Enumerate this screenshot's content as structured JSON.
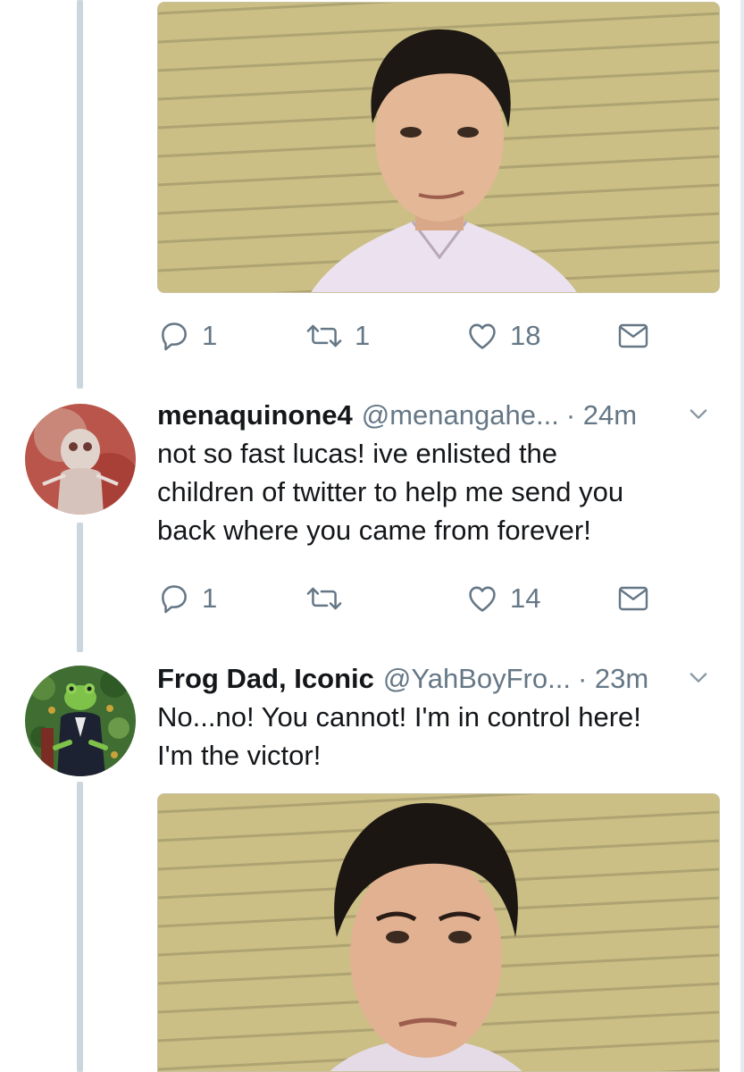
{
  "tweets": [
    {
      "id": "first",
      "image_alt": "face-edited photo of a man in a light pink shirt against siding",
      "actions": {
        "reply_count": "1",
        "retweet_count": "1",
        "like_count": "18"
      }
    },
    {
      "id": "second",
      "display_name": "menaquinone4",
      "handle": "@menangahe...",
      "time": "· 24m",
      "text_lines": [
        "not so fast lucas! ive enlisted the",
        "children of twitter to help me send you",
        "back where you came from forever!"
      ],
      "actions": {
        "reply_count": "1",
        "retweet_count": "",
        "like_count": "14"
      }
    },
    {
      "id": "third",
      "display_name": "Frog Dad, Iconic",
      "handle": "@YahBoyFro...",
      "time": "· 23m",
      "text_lines": [
        "No...no! You cannot! I'm in control here!",
        "I'm the victor!"
      ],
      "image_alt": "face-edited photo of a worried man against siding"
    }
  ],
  "icons": {
    "reply": "reply-icon",
    "retweet": "retweet-icon",
    "like": "heart-icon",
    "dm": "mail-icon",
    "caret": "chevron-down-icon"
  },
  "colors": {
    "text_primary": "#14171a",
    "text_secondary": "#657786",
    "thread_line": "#ccd6dd"
  }
}
